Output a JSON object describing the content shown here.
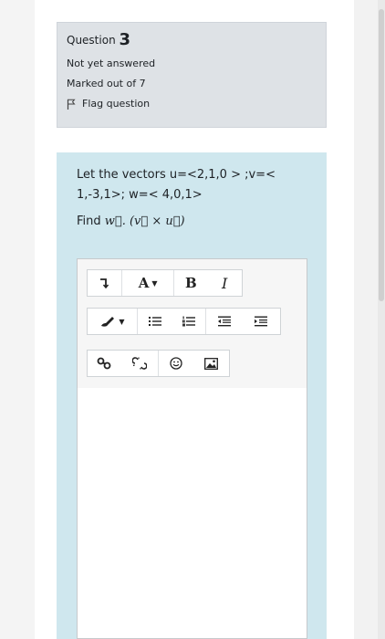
{
  "question_info": {
    "label": "Question",
    "number": "3",
    "status": "Not yet answered",
    "marks": "Marked out of 7",
    "flag_label": "Flag question"
  },
  "question": {
    "line1": "Let the vectors u=<2,1,0 > ;v=<",
    "line2": "1,-3,1>; w=< 4,0,1>",
    "find_label": "Find",
    "find_expression": "w⃗. (v⃗ × u⃗)"
  },
  "editor": {
    "toolbar": {
      "row1": [
        {
          "name": "show-more-buttons",
          "icon": "expand-arrow-icon",
          "glyph": "⤵"
        },
        {
          "name": "paragraph-styles",
          "glyph": "A"
        },
        {
          "name": "bold",
          "glyph": "B"
        },
        {
          "name": "italic",
          "glyph": "I"
        }
      ],
      "row2": [
        {
          "name": "text-color",
          "icon": "paint-brush-icon"
        },
        {
          "name": "unordered-list",
          "icon": "bullet-list-icon"
        },
        {
          "name": "ordered-list",
          "icon": "numbered-list-icon"
        },
        {
          "name": "outdent",
          "icon": "outdent-icon"
        },
        {
          "name": "indent",
          "icon": "indent-icon"
        }
      ],
      "row3": [
        {
          "name": "link",
          "icon": "link-icon"
        },
        {
          "name": "unlink",
          "icon": "unlink-icon"
        },
        {
          "name": "emoticon",
          "icon": "smiley-icon"
        },
        {
          "name": "image",
          "icon": "image-icon"
        }
      ]
    },
    "content": ""
  }
}
